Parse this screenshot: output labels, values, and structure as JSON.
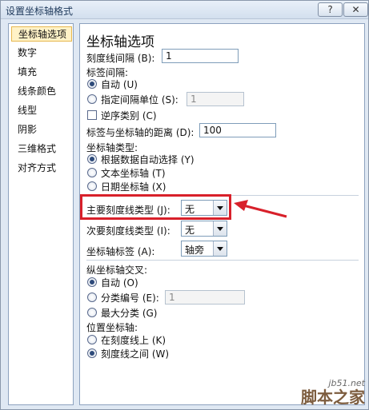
{
  "window": {
    "title": "设置坐标轴格式",
    "help_label": "?",
    "close_label": "✕"
  },
  "nav": {
    "items": [
      {
        "label": "坐标轴选项",
        "selected": true
      },
      {
        "label": "数字"
      },
      {
        "label": "填充"
      },
      {
        "label": "线条颜色"
      },
      {
        "label": "线型"
      },
      {
        "label": "阴影"
      },
      {
        "label": "三维格式"
      },
      {
        "label": "对齐方式"
      }
    ]
  },
  "panel": {
    "section_title": "坐标轴选项",
    "tick_interval_label": "刻度线间隔 (B):",
    "tick_interval_value": "1",
    "label_interval_label": "标签间隔:",
    "label_interval_auto": "自动 (U)",
    "label_interval_specify": "指定间隔单位 (S):",
    "label_interval_specify_value": "1",
    "reverse_label": "逆序类别 (C)",
    "label_distance_label": "标签与坐标轴的距离 (D):",
    "label_distance_value": "100",
    "axis_type_label": "坐标轴类型:",
    "axis_type_auto": "根据数据自动选择 (Y)",
    "axis_type_text": "文本坐标轴 (T)",
    "axis_type_date": "日期坐标轴 (X)",
    "major_tick_label": "主要刻度线类型 (J):",
    "major_tick_value": "无",
    "minor_tick_label": "次要刻度线类型 (I):",
    "minor_tick_value": "无",
    "axis_labels_label": "坐标轴标签 (A):",
    "axis_labels_value": "轴旁",
    "cross_label": "纵坐标轴交叉:",
    "cross_auto": "自动 (O)",
    "cross_category": "分类编号 (E):",
    "cross_category_value": "1",
    "cross_max": "最大分类 (G)",
    "position_label": "位置坐标轴:",
    "position_on_tick": "在刻度线上 (K)",
    "position_between": "刻度线之间 (W)"
  },
  "watermark": {
    "url": "jb51.net",
    "name": "脚本之家"
  },
  "colors": {
    "highlight": "#d8202a",
    "selected_bg": "#fff2c7"
  }
}
